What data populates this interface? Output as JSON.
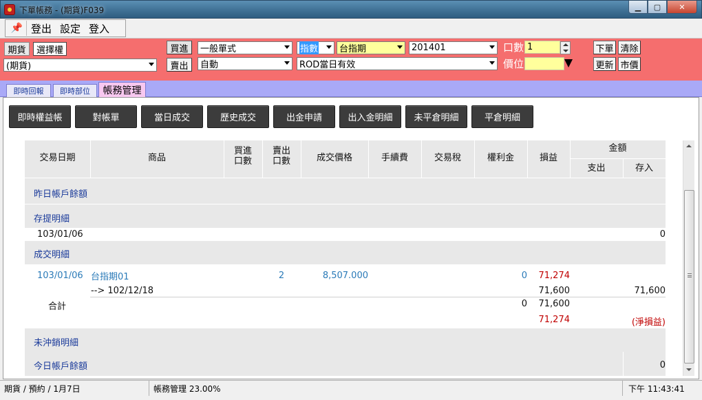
{
  "window": {
    "title": "下單帳務 - (期貨)F039"
  },
  "menu": {
    "items": [
      "登出",
      "設定",
      "登入"
    ]
  },
  "order": {
    "market_tabs": [
      "期貨",
      "選擇權"
    ],
    "account": "(期貨)",
    "buy_label": "買進",
    "sell_label": "賣出",
    "order_type": "一般單式",
    "auto_mode": "自動",
    "index_type": "指數",
    "product": "台指期",
    "month": "201401",
    "validity": "ROD當日有效",
    "qty_label": "口數",
    "qty_value": "1",
    "price_label": "價位",
    "price_value": "",
    "place_order": "下單",
    "clear": "清除",
    "refresh": "更新",
    "market_price": "市價"
  },
  "tabs": [
    {
      "label": "即時回報"
    },
    {
      "label": "即時部位"
    },
    {
      "label": "帳務管理"
    }
  ],
  "actions": [
    "即時權益帳",
    "對帳單",
    "當日成交",
    "歷史成交",
    "出金申請",
    "出入金明細",
    "未平倉明細",
    "平倉明細"
  ],
  "table": {
    "headers": {
      "date": "交易日期",
      "product": "商品",
      "buy_qty": "買進\n口數",
      "sell_qty": "賣出\n口數",
      "price": "成交價格",
      "fee": "手續費",
      "tax": "交易稅",
      "premium": "權利金",
      "pnl": "損益",
      "amount": "金額",
      "expense": "支出",
      "deposit": "存入"
    },
    "sections": {
      "prev_balance": "昨日帳戶餘額",
      "deposit_detail": "存提明細",
      "trade_detail": "成交明細",
      "open_detail": "未沖銷明細",
      "today_balance": "今日帳戶餘額"
    },
    "deposit_row": {
      "date": "103/01/06",
      "deposit": "0"
    },
    "trade_row": {
      "date": "103/01/06",
      "product": "台指期01",
      "sell_qty": "2",
      "price": "8,507.000",
      "premium": "0",
      "pnl": "71,274"
    },
    "trade_sub": {
      "product": "--> 102/12/18",
      "pnl": "71,600",
      "deposit": "71,600"
    },
    "total_row": {
      "label": "合計",
      "premium": "0",
      "pnl": "71,600"
    },
    "net_row": {
      "pnl": "71,274",
      "note": "(淨損益)"
    },
    "today_balance_value": "0"
  },
  "status": {
    "left": "期貨 / 預約 / 1月7日",
    "middle": "帳務管理 23.00%",
    "time": "下午 11:43:41"
  }
}
